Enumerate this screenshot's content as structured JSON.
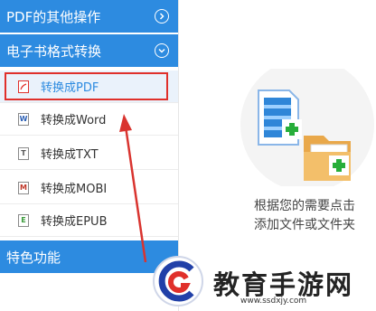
{
  "sidebar": {
    "sections": [
      {
        "label": "PDF的其他操作",
        "toggle_icon": "chevron-right-icon"
      },
      {
        "label": "电子书格式转换",
        "toggle_icon": "chevron-down-icon"
      }
    ],
    "items": [
      {
        "label": "转换成PDF",
        "icon": "pdf-file-icon",
        "icon_glyph": "",
        "icon_color": "#e0302b"
      },
      {
        "label": "转换成Word",
        "icon": "word-file-icon",
        "icon_glyph": "W",
        "icon_color": "#2b5fb4"
      },
      {
        "label": "转换成TXT",
        "icon": "txt-file-icon",
        "icon_glyph": "T",
        "icon_color": "#555555"
      },
      {
        "label": "转换成MOBI",
        "icon": "mobi-file-icon",
        "icon_glyph": "M",
        "icon_color": "#c0392b"
      },
      {
        "label": "转换成EPUB",
        "icon": "epub-file-icon",
        "icon_glyph": "E",
        "icon_color": "#3a9a3a"
      }
    ],
    "footer_section": {
      "label": "特色功能"
    }
  },
  "main": {
    "hint_line1": "根据您的需要点击",
    "hint_line2": "添加文件或文件夹"
  },
  "watermark": {
    "text": "教育手游网",
    "url": "www.ssdxjy.com"
  },
  "colors": {
    "accent": "#2d8be0",
    "highlight": "#e0302b",
    "add_plus": "#27ae3a",
    "folder": "#f0b35a"
  }
}
